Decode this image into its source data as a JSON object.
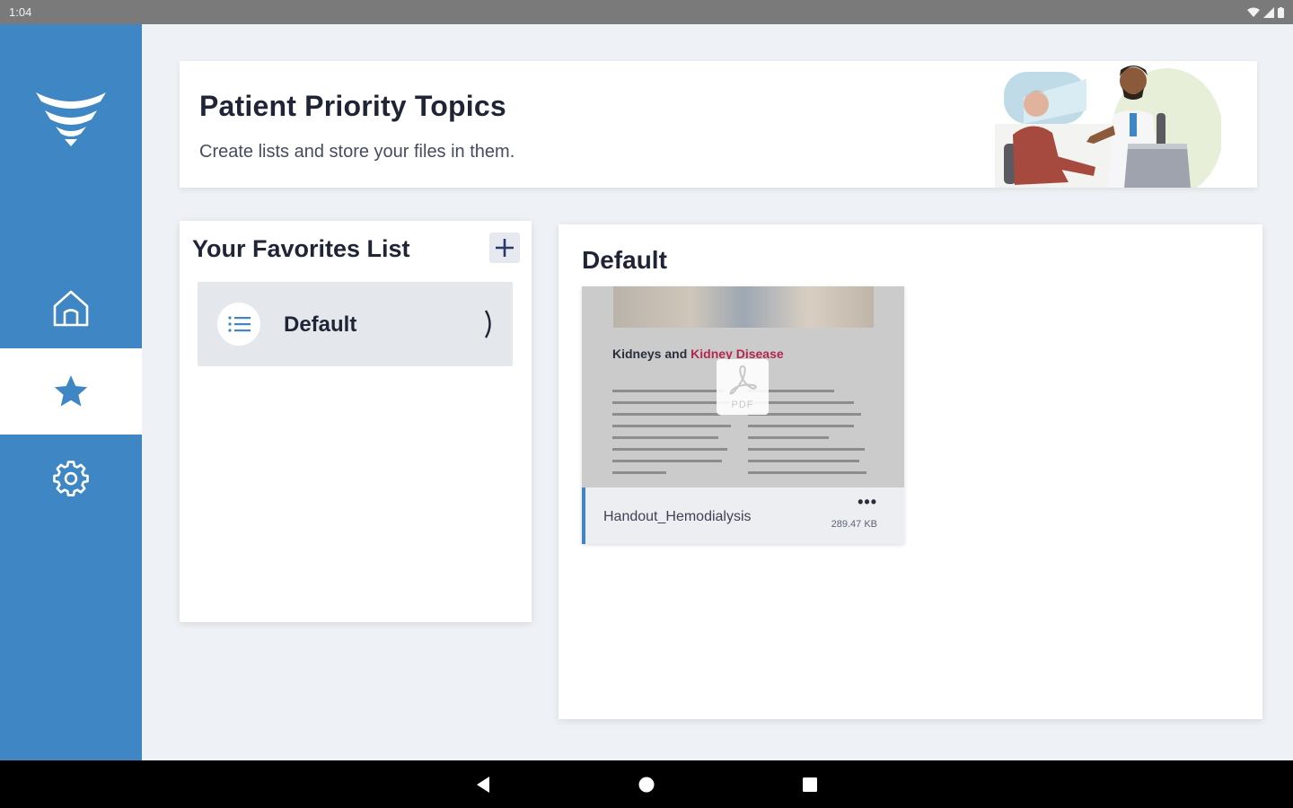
{
  "status_bar": {
    "time": "1:04"
  },
  "sidebar": {
    "logo_icon": "chevron-stack-logo",
    "items": [
      {
        "id": "home",
        "icon": "home-icon",
        "active": false
      },
      {
        "id": "favorites",
        "icon": "star-icon",
        "active": true
      },
      {
        "id": "settings",
        "icon": "gear-icon",
        "active": false
      }
    ]
  },
  "header": {
    "title": "Patient Priority Topics",
    "subtitle": "Create lists and store your files in them."
  },
  "favorites": {
    "title": "Your Favorites List",
    "add_icon": "plus-icon",
    "lists": [
      {
        "label": "Default",
        "icon": "list-icon"
      }
    ]
  },
  "detail": {
    "title": "Default",
    "files": [
      {
        "name": "Handout_Hemodialysis",
        "size": "289.47 KB",
        "type_label": "PDF",
        "menu_label": "•••",
        "thumbnail": {
          "heading_part1": "Kidneys and ",
          "heading_part2": "Kidney Disease"
        }
      }
    ]
  },
  "colors": {
    "sidebar": "#3f86c4",
    "background": "#eef1f5",
    "accent_red": "#b1284f"
  }
}
